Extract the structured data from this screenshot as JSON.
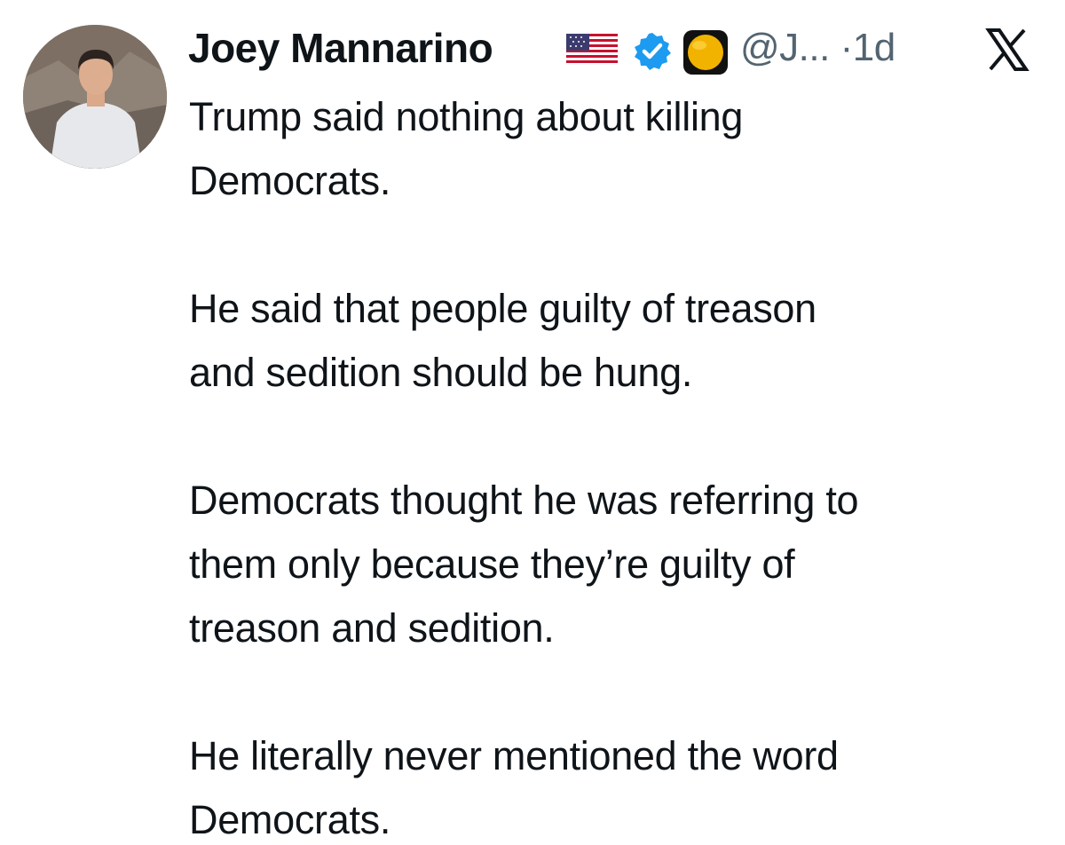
{
  "tweet": {
    "author": {
      "display_name": "Joey Mannarino",
      "handle": "@J...",
      "separator": "·",
      "time": "1d",
      "badges": [
        "us-flag-icon",
        "verified-badge-icon",
        "affiliate-badge-icon"
      ]
    },
    "platform_icon": "x-logo-icon",
    "paragraphs": [
      [
        "Trump said nothing about killing",
        "Democrats."
      ],
      [
        "He said that people guilty of treason",
        "and sedition should be hung."
      ],
      [
        "Democrats thought he was referring to",
        "them only because they’re guilty of",
        "treason and sedition."
      ],
      [
        "He literally never mentioned the word",
        "Democrats."
      ]
    ]
  },
  "colors": {
    "text": "#0f1419",
    "secondary_text": "#536471",
    "verified_blue": "#1d9bf0",
    "affiliate_gold": "#f2b300"
  }
}
